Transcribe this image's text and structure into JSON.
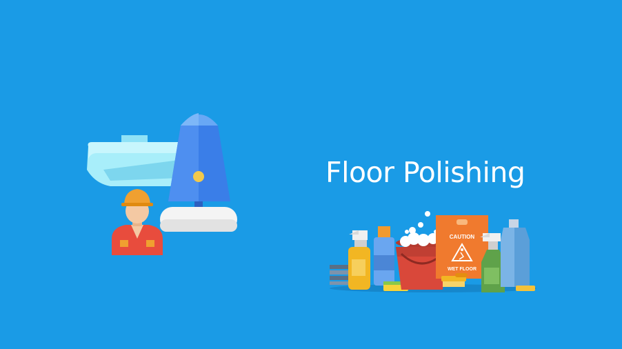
{
  "slide": {
    "title": "Floor Polishing",
    "background_color": "#1a9be6"
  },
  "illustrations": {
    "machine_icon": "floor-polisher-icon",
    "worker_icon": "worker-icon",
    "supplies_icon": "cleaning-supplies-icon",
    "sign_text_top": "CAUTION",
    "sign_text_bottom": "WET FLOOR"
  }
}
